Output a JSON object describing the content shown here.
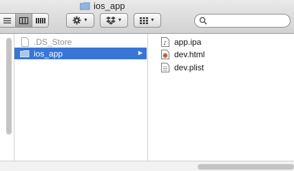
{
  "window": {
    "title": "ios_app"
  },
  "toolbar": {
    "view_buttons": [
      "list-view-icon",
      "column-view-icon",
      "coverflow-view-icon"
    ],
    "action_icon": "gear-icon",
    "share_icon": "dropbox-icon",
    "arrange_icon": "grid-icon",
    "search_placeholder": ""
  },
  "column_parent": {
    "items": [
      {
        "label": ".DS_Store",
        "state": "dim"
      },
      {
        "label": "ios_app",
        "state": "selected"
      }
    ]
  },
  "column_contents": {
    "items": [
      {
        "label": "app.ipa",
        "icon": "package-file-icon"
      },
      {
        "label": "dev.html",
        "icon": "html-file-icon"
      },
      {
        "label": "dev.plist",
        "icon": "plist-file-icon"
      }
    ]
  },
  "colors": {
    "selection": "#3875d7",
    "folder": "#7fa9d8"
  }
}
